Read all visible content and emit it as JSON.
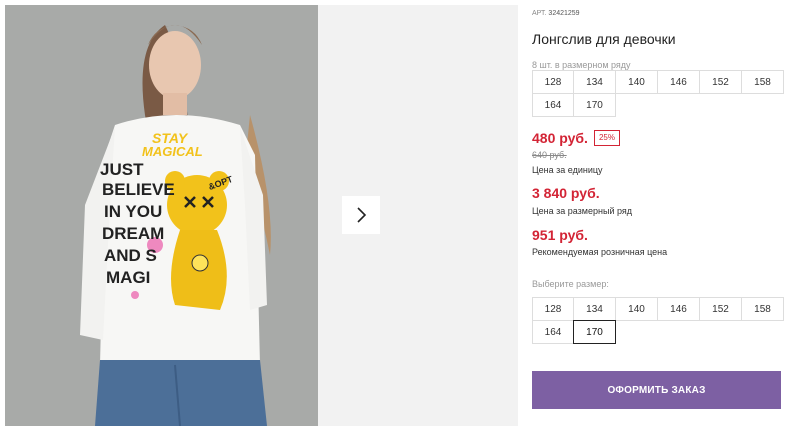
{
  "gallery": {
    "print_text": [
      "STAY",
      "MAGICAL",
      "JUST",
      "BELIEVE",
      "IN YOU",
      "DREAM",
      "AND S",
      "MAGI",
      "&OPT"
    ],
    "next_icon": "chevron-right-icon"
  },
  "product": {
    "sku_label": "АРТ.",
    "sku": "32421259",
    "title": "Лонгслив для девочки",
    "size_note": "8 шт. в размерном ряду",
    "sizes_series": [
      "128",
      "134",
      "140",
      "146",
      "152",
      "158",
      "164",
      "170"
    ]
  },
  "pricing": {
    "price": "480 руб.",
    "discount": "25%",
    "old_price": "640 руб.",
    "unit_caption": "Цена за единицу",
    "set_price": "3 840 руб.",
    "set_caption": "Цена за размерный ряд",
    "rrp": "951 руб.",
    "rrp_caption": "Рекомендуемая розничная цена"
  },
  "size_select": {
    "label": "Выберите размер:",
    "options": [
      "128",
      "134",
      "140",
      "146",
      "152",
      "158",
      "164",
      "170"
    ],
    "selected": "170"
  },
  "actions": {
    "order_label": "ОФОРМИТЬ ЗАКАЗ"
  },
  "colors": {
    "price": "#d32435",
    "button": "#7d60a3",
    "print_yellow": "#f2c21b"
  }
}
